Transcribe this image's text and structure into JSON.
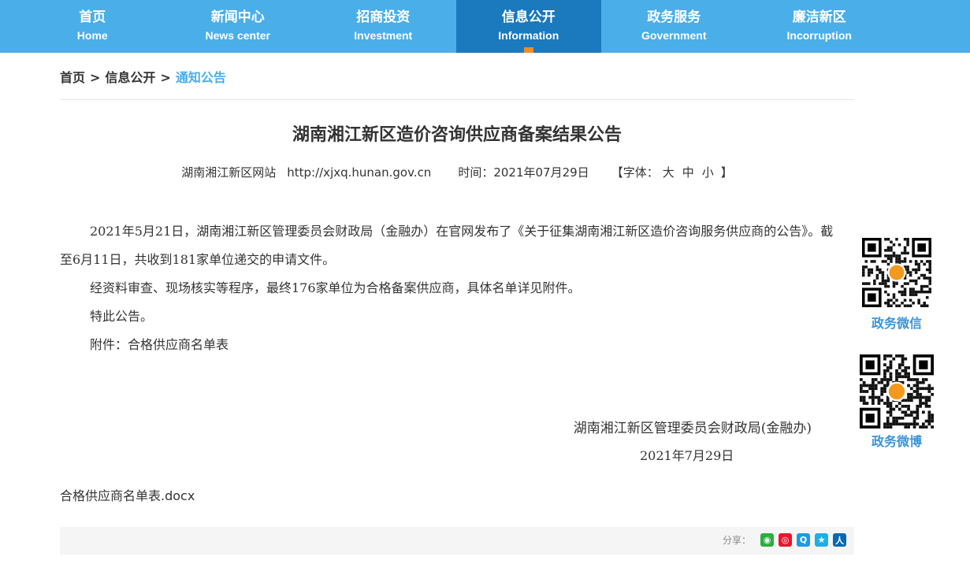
{
  "nav": {
    "items": [
      {
        "cn": "首页",
        "en": "Home",
        "active": false
      },
      {
        "cn": "新闻中心",
        "en": "News center",
        "active": false
      },
      {
        "cn": "招商投资",
        "en": "Investment",
        "active": false
      },
      {
        "cn": "信息公开",
        "en": "Information",
        "active": true
      },
      {
        "cn": "政务服务",
        "en": "Government",
        "active": false
      },
      {
        "cn": "廉洁新区",
        "en": "Incorruption",
        "active": false
      }
    ]
  },
  "breadcrumb": {
    "home": "首页",
    "sep1": ">",
    "section": "信息公开",
    "sep2": ">",
    "current": "通知公告"
  },
  "article": {
    "title": "湖南湘江新区造价咨询供应商备案结果公告",
    "source": "湖南湘江新区网站",
    "url": "http://xjxq.hunan.gov.cn",
    "time": "时间：2021年07月29日",
    "font_label": "【字体：",
    "font_large": "大",
    "font_medium": "中",
    "font_small": "小",
    "font_close": "】",
    "paragraphs": [
      "2021年5月21日，湖南湘江新区管理委员会财政局（金融办）在官网发布了《关于征集湖南湘江新区造价咨询服务供应商的公告》。截至6月11日，共收到181家单位递交的申请文件。",
      "经资料审查、现场核实等程序，最终176家单位为合格备案供应商，具体名单详见附件。",
      "特此公告。",
      "附件：合格供应商名单表"
    ],
    "signature": "湖南湘江新区管理委员会财政局(金融办)",
    "sign_date": "2021年7月29日",
    "attachment": "合格供应商名单表.docx"
  },
  "share": {
    "label": "分享：",
    "icons": [
      {
        "name": "wechat-icon",
        "color": "#2aae3f",
        "glyph": "◉"
      },
      {
        "name": "weibo-icon",
        "color": "#e6162d",
        "glyph": "◎"
      },
      {
        "name": "qzone-icon",
        "color": "#1a9be6",
        "glyph": "Q"
      },
      {
        "name": "qq-icon",
        "color": "#1ab0e8",
        "glyph": "★"
      },
      {
        "name": "renren-icon",
        "color": "#0a68b4",
        "glyph": "人"
      }
    ]
  },
  "sidebar": {
    "wechat_label": "政务微信",
    "weibo_label": "政务微博"
  },
  "colors": {
    "nav_bg": "#4aaee8",
    "nav_active": "#1b79bd",
    "nav_marker": "#f08a2a",
    "accent": "#4aaee8",
    "qr_label": "#3b94d9"
  }
}
